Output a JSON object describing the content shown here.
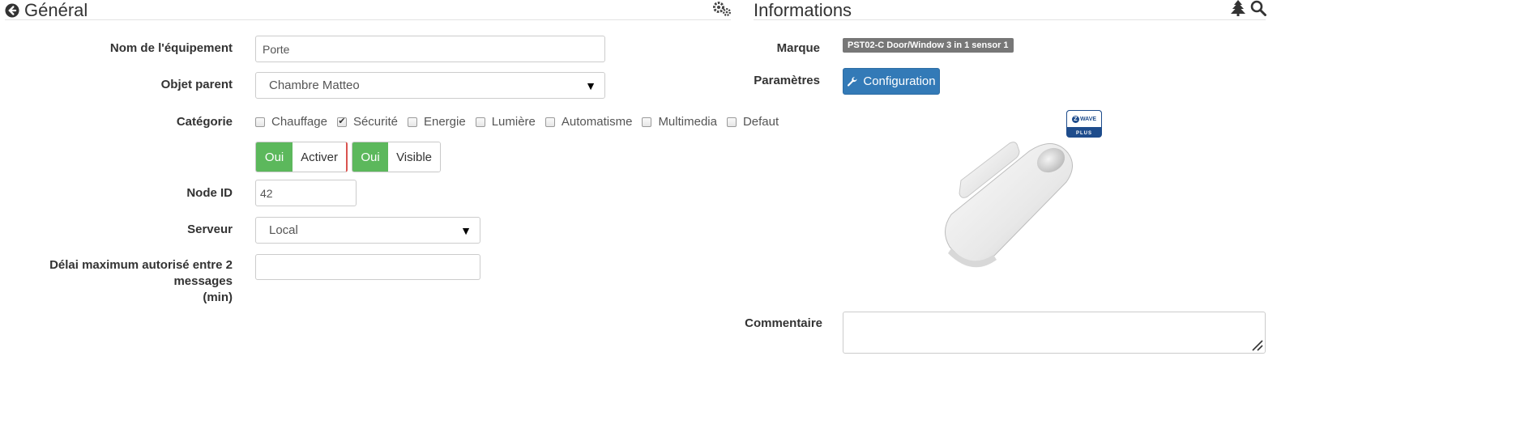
{
  "general": {
    "title": "Général",
    "fields": {
      "name_label": "Nom de l'équipement",
      "name_value": "Porte",
      "parent_label": "Objet parent",
      "parent_value": "Chambre Matteo",
      "category_label": "Catégorie",
      "node_label": "Node ID",
      "node_value": "42",
      "server_label": "Serveur",
      "server_value": "Local",
      "delay_label_line1": "Délai maximum autorisé entre 2 messages",
      "delay_label_line2": "(min)",
      "delay_value": ""
    },
    "categories": [
      {
        "label": "Chauffage",
        "checked": false
      },
      {
        "label": "Sécurité",
        "checked": true
      },
      {
        "label": "Energie",
        "checked": false
      },
      {
        "label": "Lumière",
        "checked": false
      },
      {
        "label": "Automatisme",
        "checked": false
      },
      {
        "label": "Multimedia",
        "checked": false
      },
      {
        "label": "Defaut",
        "checked": false
      }
    ],
    "toggles": {
      "enable_on": "Oui",
      "enable_label": "Activer",
      "visible_on": "Oui",
      "visible_label": "Visible"
    },
    "icons": {
      "back": "back-circle-icon",
      "settings": "gears-icon"
    }
  },
  "info": {
    "title": "Informations",
    "brand_label": "Marque",
    "brand_value": "PST02-C Door/Window 3 in 1 sensor 1",
    "params_label": "Paramètres",
    "config_button": "Configuration",
    "zwave_logo_text": "WAVE",
    "zwave_plus_text": "PLUS",
    "comment_label": "Commentaire",
    "comment_value": "",
    "icons": {
      "tree": "tree-icon",
      "search": "search-icon"
    }
  },
  "colors": {
    "success": "#5cb85c",
    "primary": "#337ab7",
    "badge": "#777777",
    "zwave": "#1e4c8c"
  }
}
